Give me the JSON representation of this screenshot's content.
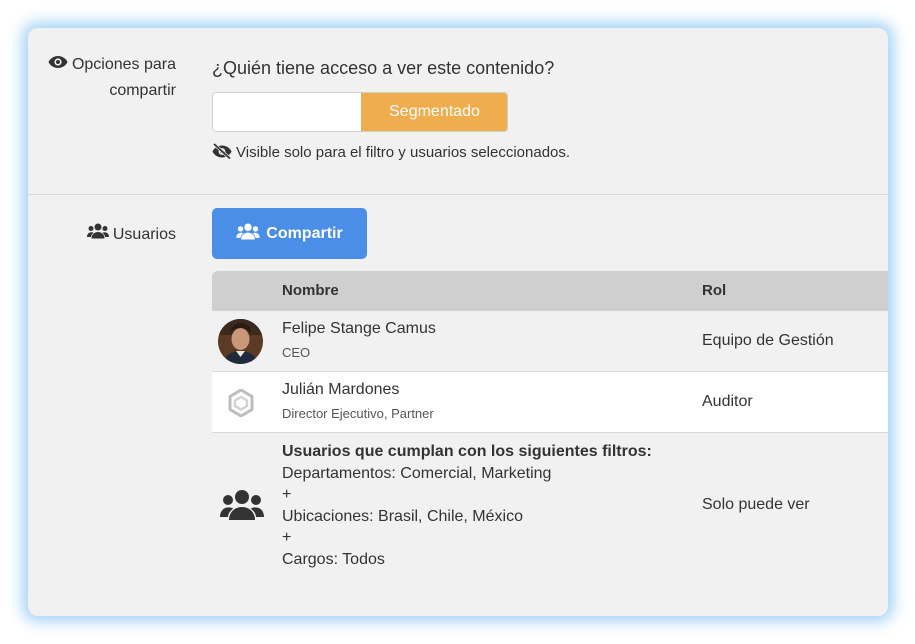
{
  "sharing": {
    "label_line1": "Opciones para",
    "label_line2": "compartir",
    "label_icon": "eye-icon",
    "question": "¿Quién tiene acceso a ver este contenido?",
    "input_value": "",
    "segment_button": "Segmentado",
    "visibility_icon": "eye-slash-icon",
    "visibility_note": "Visible solo para el filtro y usuarios seleccionados."
  },
  "users": {
    "label": "Usuarios",
    "label_icon": "users-icon",
    "share_button": "Compartir",
    "share_button_icon": "users-icon"
  },
  "table": {
    "columns": [
      "Nombre",
      "Rol"
    ],
    "rows": [
      {
        "name": "Felipe Stange Camus",
        "subtitle": "CEO",
        "role": "Equipo de Gestión",
        "avatar": "user-photo"
      },
      {
        "name": "Julián Mardones",
        "subtitle": "Director Ejecutivo, Partner",
        "role": "Auditor",
        "avatar": "hexagon-logo-icon"
      },
      {
        "filter_title": "Usuarios que cumplan con los siguientes filtros:",
        "filter_lines": [
          "Departamentos: Comercial, Marketing",
          "+",
          "Ubicaciones: Brasil, Chile, México",
          "+",
          "Cargos: Todos"
        ],
        "role": "Solo puede ver",
        "avatar": "group-icon"
      }
    ]
  },
  "colors": {
    "segment_button_bg": "#f0ad4e",
    "share_button_bg": "#4a8ee8",
    "card_glow": "#3ca0eb"
  }
}
